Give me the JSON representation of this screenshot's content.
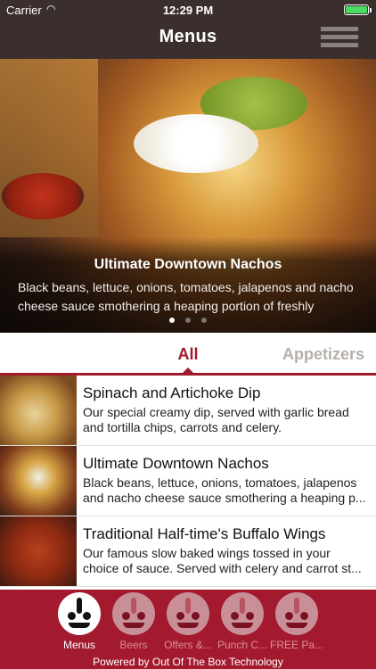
{
  "status": {
    "carrier": "Carrier",
    "time": "12:29 PM",
    "battery_level": 1.0
  },
  "nav": {
    "title": "Menus",
    "menu_icon": "hamburger-icon"
  },
  "hero": {
    "title": "Ultimate Downtown Nachos",
    "description": "Black beans, lettuce, onions, tomatoes, jalapenos and nacho cheese sauce smothering a heaping portion of freshly",
    "page_count": 3,
    "active_page": 1
  },
  "tabs": [
    {
      "label": "All",
      "active": true
    },
    {
      "label": "Appetizers",
      "active": false
    }
  ],
  "items": [
    {
      "name": "Spinach and Artichoke Dip",
      "desc_line1": "Our special creamy dip, served with garlic bread",
      "desc_line2": "and tortilla chips, carrots and celery."
    },
    {
      "name": "Ultimate Downtown Nachos",
      "desc_line1": "Black beans, lettuce, onions, tomatoes, jalapenos",
      "desc_line2": "and nacho cheese sauce smothering a heaping p..."
    },
    {
      "name": "Traditional Half-time's Buffalo Wings",
      "desc_line1": "Our famous slow baked wings tossed in your",
      "desc_line2": "choice of sauce. Served with celery and carrot st..."
    }
  ],
  "bottom_tabs": [
    {
      "label": "Menus",
      "active": true
    },
    {
      "label": "Beers",
      "active": false
    },
    {
      "label": "Offers &...",
      "active": false
    },
    {
      "label": "Punch C...",
      "active": false
    },
    {
      "label": "FREE Pa...",
      "active": false
    }
  ],
  "footer": {
    "powered_by": "Powered by Out Of The Box Technology"
  },
  "colors": {
    "nav_bg": "#3a2f2c",
    "accent": "#a01a2d",
    "bottom_bar": "#a31a2f",
    "inactive_tab_text": "#b5b0ab"
  }
}
